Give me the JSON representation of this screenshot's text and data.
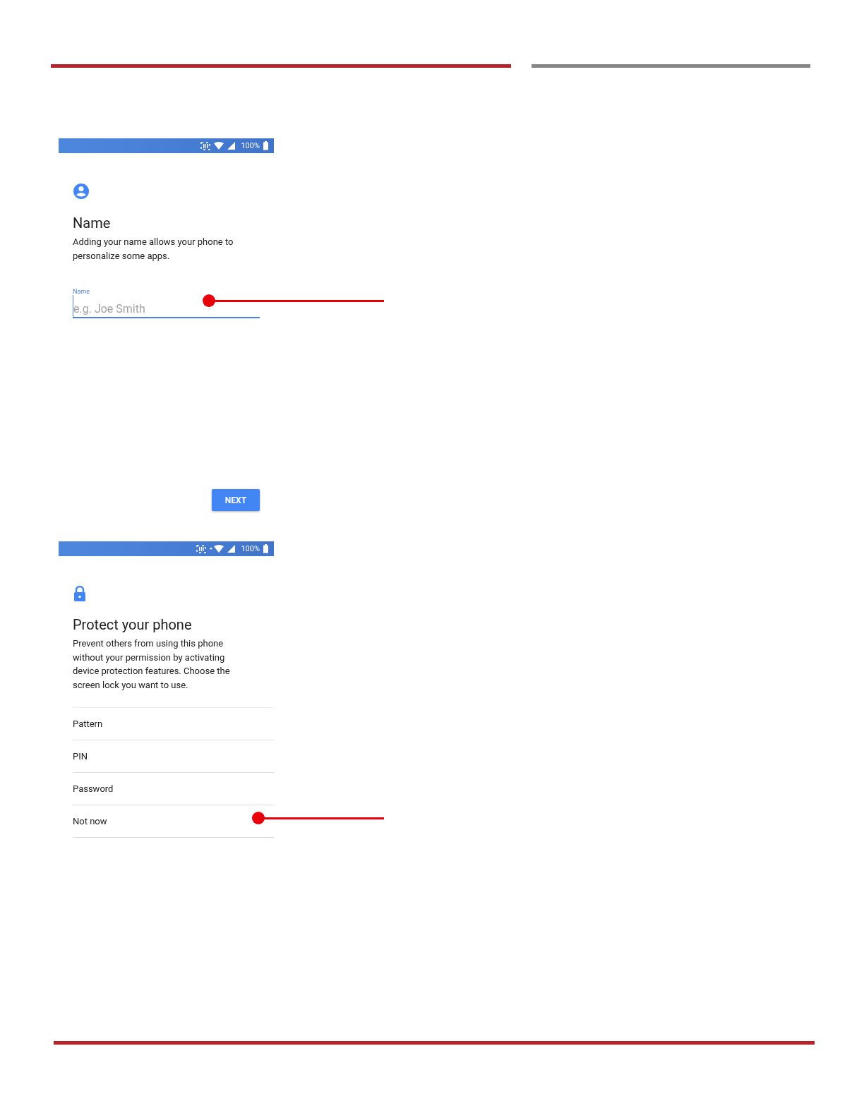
{
  "name_screen": {
    "status_bar": {
      "battery": "100%"
    },
    "title": "Name",
    "description": "Adding your name allows your phone to personalize some apps.",
    "field": {
      "label": "Name",
      "placeholder": "e.g. Joe Smith"
    },
    "next_button": "NEXT"
  },
  "protect_screen": {
    "status_bar": {
      "battery": "100%"
    },
    "title": "Protect your phone",
    "description": "Prevent others from using this phone without your permission by activating device protection features. Choose the screen lock you want to use.",
    "options": [
      "Pattern",
      "PIN",
      "Password",
      "Not now"
    ]
  }
}
